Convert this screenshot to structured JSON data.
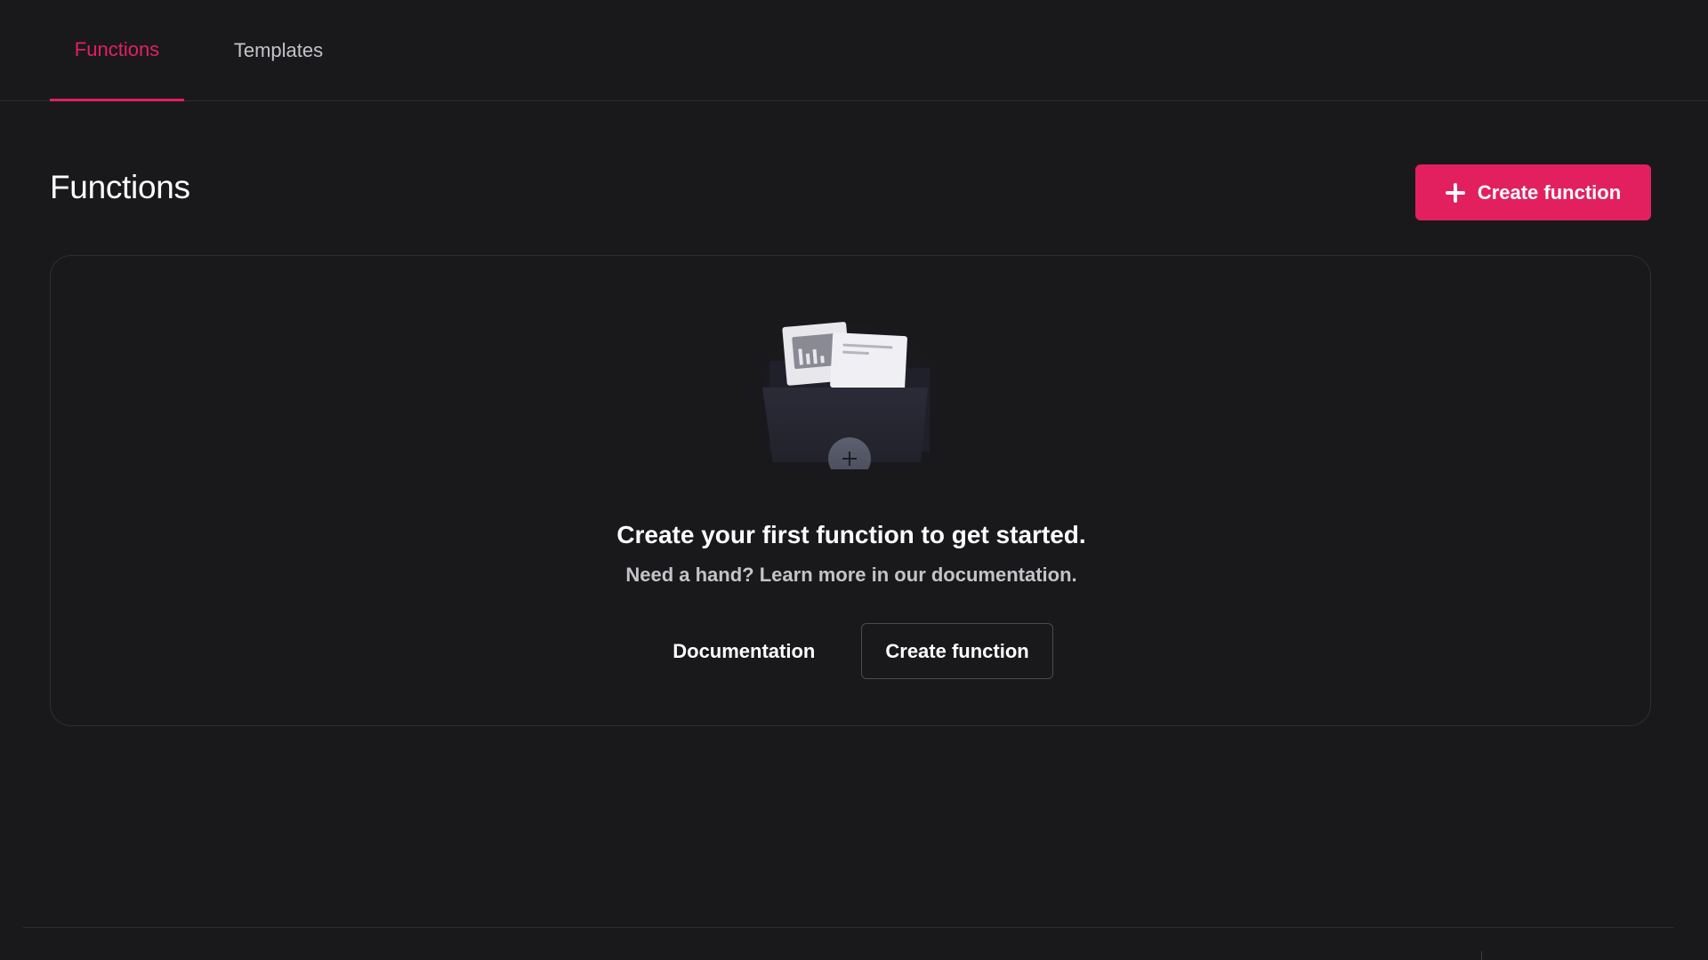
{
  "tabs": [
    {
      "label": "Functions",
      "active": true
    },
    {
      "label": "Templates",
      "active": false
    }
  ],
  "header": {
    "title": "Functions",
    "create_button_label": "Create function",
    "create_button_icon": "plus-icon"
  },
  "empty_state": {
    "illustration": "folder-with-documents-illustration",
    "title": "Create your first function to get started.",
    "subtitle": "Need a hand? Learn more in our documentation.",
    "documentation_button_label": "Documentation",
    "create_button_label": "Create function"
  },
  "colors": {
    "background": "#19191c",
    "accent": "#e2205f",
    "border": "#2e2e33",
    "muted_text": "#c3c3c8"
  }
}
